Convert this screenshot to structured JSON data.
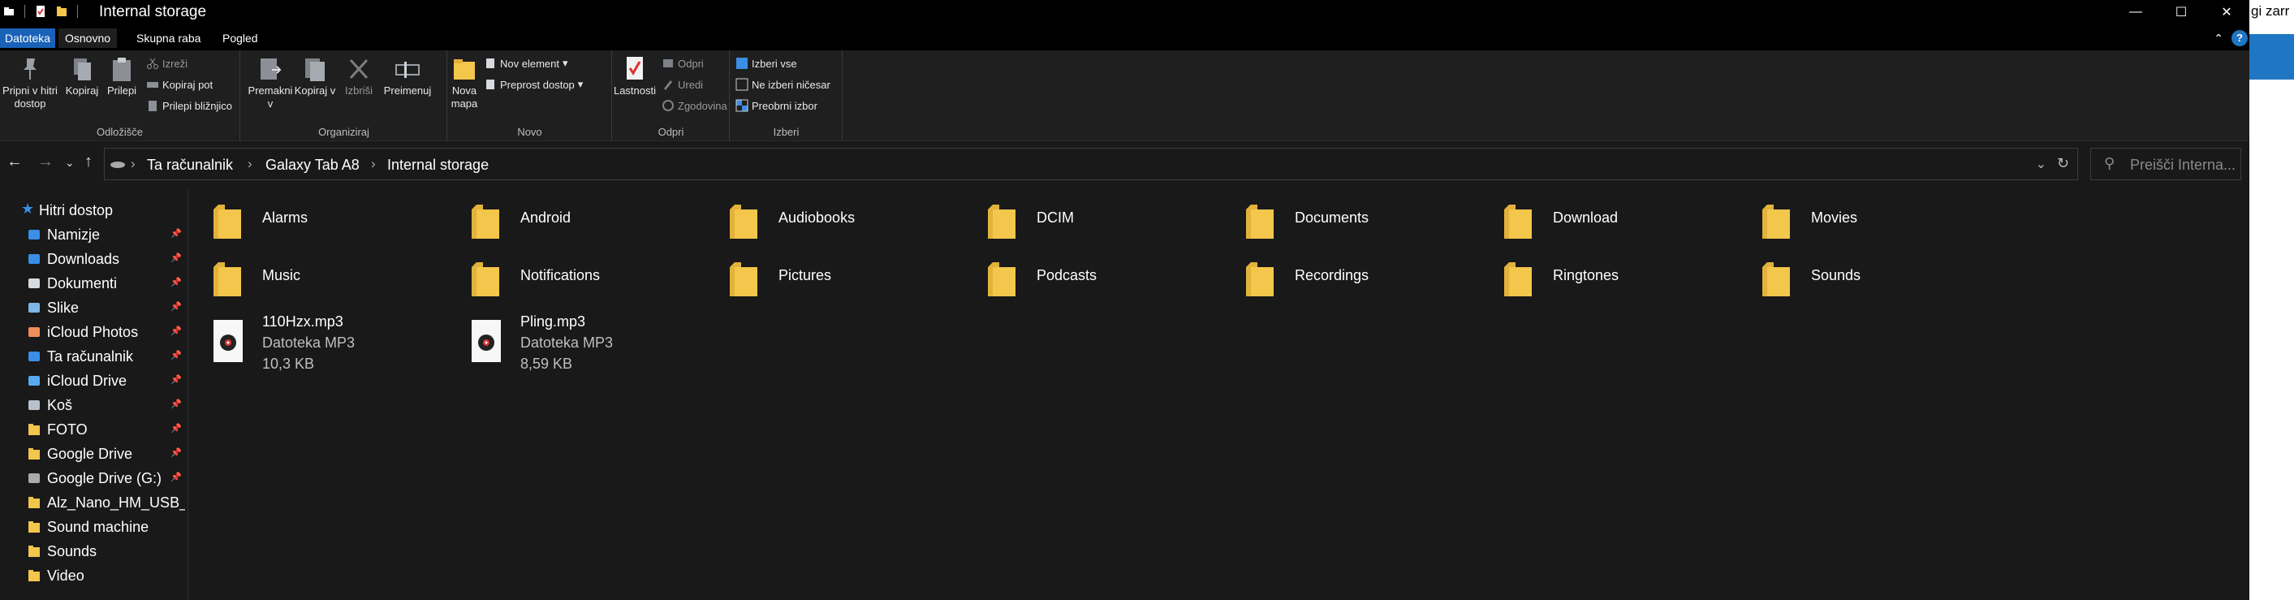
{
  "window": {
    "title": "Internal storage",
    "min_symbol": "—",
    "max_symbol": "☐",
    "close_symbol": "✕"
  },
  "background_app": {
    "visible_text": "gi zarr"
  },
  "ribbon_tabs": [
    {
      "label": "Datoteka"
    },
    {
      "label": "Osnovno"
    },
    {
      "label": "Skupna raba"
    },
    {
      "label": "Pogled"
    }
  ],
  "ribbon": {
    "clipboard": {
      "pin_label": "Pripni v hitri dostop",
      "copy_label": "Kopiraj",
      "paste_label": "Prilepi",
      "cut_label": "Izreži",
      "copy_path_label": "Kopiraj pot",
      "paste_shortcut_label": "Prilepi bližnjico",
      "group_label": "Odložišče"
    },
    "organize": {
      "move_label": "Premakni v",
      "copyto_label": "Kopiraj v",
      "delete_label": "Izbriši",
      "rename_label": "Preimenuj",
      "group_label": "Organiziraj"
    },
    "new": {
      "new_folder_label": "Nova mapa",
      "new_item_label": "Nov element",
      "easy_access_label": "Preprost dostop",
      "group_label": "Novo"
    },
    "open": {
      "properties_label": "Lastnosti",
      "open_label": "Odpri",
      "edit_label": "Uredi",
      "history_label": "Zgodovina",
      "group_label": "Odpri"
    },
    "select": {
      "select_all_label": "Izberi vse",
      "select_none_label": "Ne izberi ničesar",
      "invert_label": "Preobrni izbor",
      "group_label": "Izberi"
    }
  },
  "address": {
    "crumbs": [
      "Ta računalnik",
      "Galaxy Tab A8",
      "Internal storage"
    ],
    "separator": "›"
  },
  "search": {
    "placeholder": "Preišči Interna..."
  },
  "sidebar": {
    "quick_access_label": "Hitri dostop",
    "items": [
      {
        "label": "Namizje",
        "icon": "desktop-icon",
        "pinned": true
      },
      {
        "label": "Downloads",
        "icon": "download-icon",
        "pinned": true
      },
      {
        "label": "Dokumenti",
        "icon": "document-icon",
        "pinned": true
      },
      {
        "label": "Slike",
        "icon": "pictures-icon",
        "pinned": true
      },
      {
        "label": "iCloud Photos",
        "icon": "icloud-photos-icon",
        "pinned": true
      },
      {
        "label": "Ta računalnik",
        "icon": "computer-icon",
        "pinned": true
      },
      {
        "label": "iCloud Drive",
        "icon": "icloud-drive-icon",
        "pinned": true
      },
      {
        "label": "Koš",
        "icon": "recycle-bin-icon",
        "pinned": true
      },
      {
        "label": "FOTO",
        "icon": "folder-icon",
        "pinned": true
      },
      {
        "label": "Google Drive",
        "icon": "folder-icon",
        "pinned": true
      },
      {
        "label": "Google Drive (G:)",
        "icon": "drive-icon",
        "pinned": true
      },
      {
        "label": "Alz_Nano_HM_USB_",
        "icon": "folder-icon",
        "pinned": false
      },
      {
        "label": "Sound machine",
        "icon": "folder-icon",
        "pinned": false
      },
      {
        "label": "Sounds",
        "icon": "folder-icon",
        "pinned": false
      },
      {
        "label": "Video",
        "icon": "folder-icon",
        "pinned": false
      }
    ]
  },
  "folders": [
    "Alarms",
    "Android",
    "Audiobooks",
    "DCIM",
    "Documents",
    "Download",
    "Movies",
    "Music",
    "Notifications",
    "Pictures",
    "Podcasts",
    "Recordings",
    "Ringtones",
    "Sounds"
  ],
  "files": [
    {
      "name": "110Hzx.mp3",
      "type": "Datoteka MP3",
      "size": "10,3 KB"
    },
    {
      "name": "Pling.mp3",
      "type": "Datoteka MP3",
      "size": "8,59 KB"
    }
  ],
  "colors": {
    "folder_yellow": "#f3c64c",
    "accent_blue": "#1a62b8",
    "background": "#191919"
  }
}
